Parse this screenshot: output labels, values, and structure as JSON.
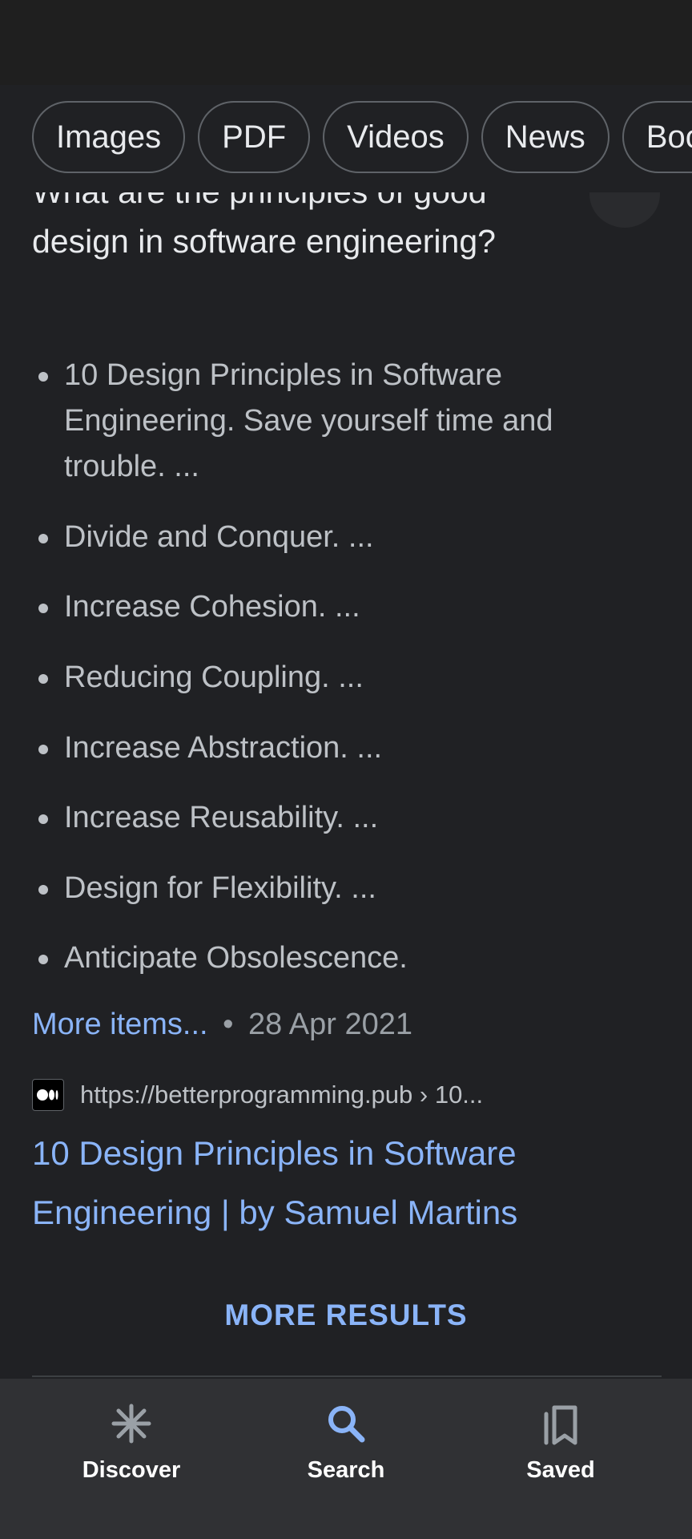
{
  "filter_chips": [
    "Images",
    "PDF",
    "Videos",
    "News",
    "Books"
  ],
  "question": "What are the principles of good design in software engineering?",
  "answer_items": [
    "10 Design Principles in Software Engineering. Save yourself time and trouble. ...",
    "Divide and Conquer. ...",
    "Increase Cohesion. ...",
    "Reducing Coupling. ...",
    "Increase Abstraction. ...",
    "Increase Reusability. ...",
    "Design for Flexibility. ...",
    "Anticipate Obsolescence."
  ],
  "more_items_label": "More items...",
  "separator": "•",
  "date": "28 Apr 2021",
  "source": {
    "url": "https://betterprogramming.pub › 10...",
    "favicon": "medium-logo-icon"
  },
  "result_title": "10 Design Principles in Software Engineering | by Samuel Martins",
  "more_results_label": "MORE RESULTS",
  "bottom_nav": {
    "discover": "Discover",
    "search": "Search",
    "saved": "Saved"
  },
  "colors": {
    "background": "#202124",
    "link": "#8ab4f8",
    "text": "#bdc1c6",
    "nav_background": "#303134",
    "active_icon": "#8ab4f8"
  }
}
